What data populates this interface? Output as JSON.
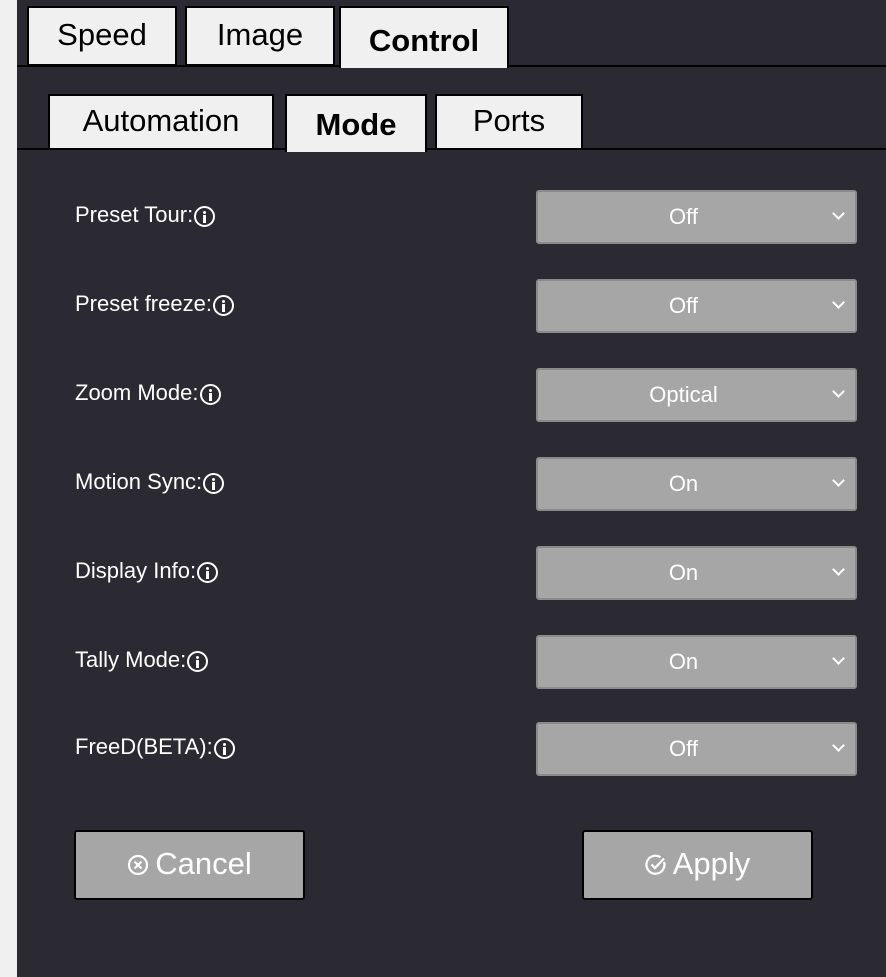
{
  "top_tabs": [
    {
      "label": "Speed"
    },
    {
      "label": "Image"
    },
    {
      "label": "Control"
    }
  ],
  "sub_tabs": [
    {
      "label": "Automation"
    },
    {
      "label": "Mode"
    },
    {
      "label": "Ports"
    }
  ],
  "settings": [
    {
      "label": "Preset Tour:",
      "value": "Off"
    },
    {
      "label": "Preset freeze:",
      "value": "Off"
    },
    {
      "label": "Zoom Mode:",
      "value": "Optical"
    },
    {
      "label": "Motion Sync:",
      "value": "On"
    },
    {
      "label": "Display Info:",
      "value": "On"
    },
    {
      "label": "Tally Mode:",
      "value": "On"
    },
    {
      "label": "FreeD(BETA):",
      "value": "Off"
    }
  ],
  "buttons": {
    "cancel_label": "Cancel",
    "apply_label": "Apply"
  },
  "colors": {
    "panel_bg": "#2b2a33",
    "tab_bg": "#f0f0f0",
    "control_bg": "#a6a6a6",
    "text_light": "#ffffff"
  },
  "icons": {
    "info": "info-icon",
    "dropdown": "chevron-down-icon",
    "cancel": "cancel-circle-icon",
    "apply": "check-circle-icon"
  }
}
